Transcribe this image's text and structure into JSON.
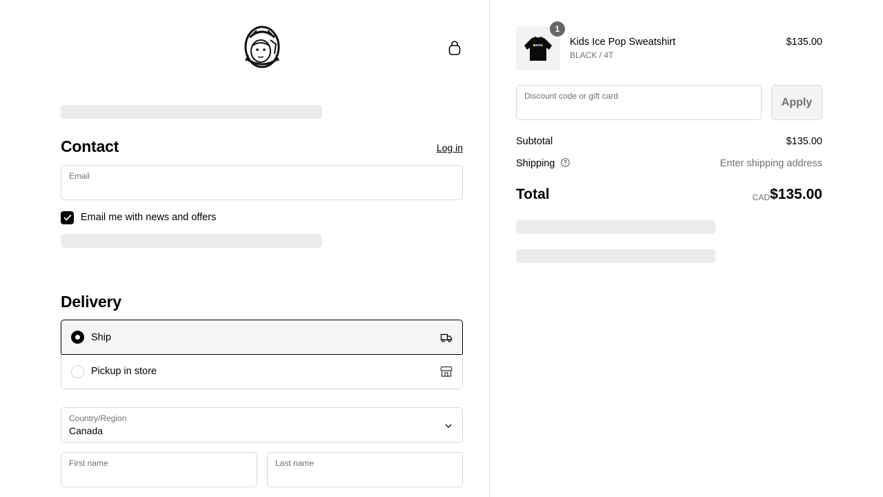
{
  "header": {
    "logo_icon": "astronaut-helmet-logo",
    "cart_icon": "shopping-bag-icon"
  },
  "contact": {
    "title": "Contact",
    "login_label": "Log in",
    "email_label": "Email",
    "email_value": "",
    "marketing_checked": true,
    "marketing_label": "Email me with news and offers"
  },
  "delivery": {
    "title": "Delivery",
    "options": [
      {
        "label": "Ship",
        "selected": true,
        "icon": "truck-icon"
      },
      {
        "label": "Pickup in store",
        "selected": false,
        "icon": "store-icon"
      }
    ],
    "country_label": "Country/Region",
    "country_value": "Canada",
    "first_name_label": "First name",
    "last_name_label": "Last name"
  },
  "order": {
    "item": {
      "quantity": "1",
      "name": "Kids Ice Pop Sweatshirt",
      "variant": "BLACK / 4T",
      "price": "$135.00"
    },
    "discount_placeholder": "Discount code or gift card",
    "apply_label": "Apply",
    "subtotal_label": "Subtotal",
    "subtotal_value": "$135.00",
    "shipping_label": "Shipping",
    "shipping_value": "Enter shipping address",
    "total_label": "Total",
    "total_currency": "CAD",
    "total_value": "$135.00"
  },
  "colors": {
    "accent": "#000000",
    "skeleton": "#ebebeb",
    "border": "#d9d9d9",
    "muted_text": "#707070"
  }
}
